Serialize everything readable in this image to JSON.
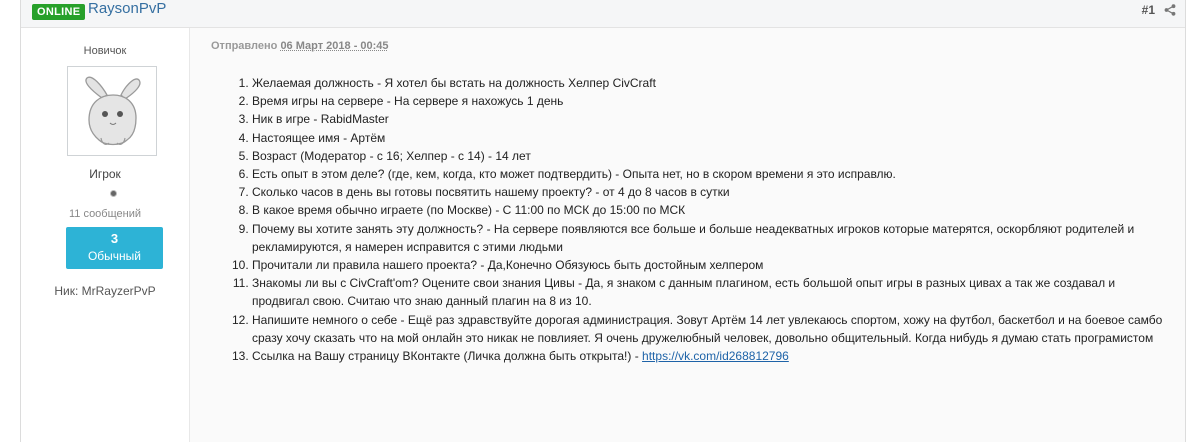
{
  "header": {
    "status_badge": "ONLINE",
    "author": "RaysonPvP",
    "post_number": "#1",
    "share_icon": "share-icon"
  },
  "author_panel": {
    "rank_title": "Новичок",
    "avatar_icon": "rabbit-avatar",
    "group": "Игрок",
    "post_count": "11 сообщений",
    "reputation_value": "3",
    "reputation_label": "Обычный",
    "nick": "Ник: MrRayzerPvP"
  },
  "post": {
    "date_prefix": "Отправлено",
    "date": "06 Март 2018 - 00:45",
    "items": [
      "Желаемая должность - Я хотел бы встать на должность Хелпер CivCraft",
      "Время игры на сервере  - На сервере я нахожусь 1 день",
      "Ник в игре - RabidMaster",
      "Настоящее имя - Артём",
      "Возраст  (Модератор - с 16; Хелпер - с 14) - 14 лет",
      "Есть опыт в этом деле? (где, кем, когда, кто может подтвердить) - Опыта нет, но в скором времени я это исправлю.",
      "Сколько часов в день вы готовы посвятить нашему проекту? - от 4 до 8 часов в сутки",
      "В какое время обычно играете (по Москве) - С 11:00 по МСК до 15:00 по МСК",
      "Почему вы хотите занять эту должность? - На сервере появляются все больше и больше неадекватных игроков которые матерятся, оскорбляют родителей и рекламируются, я намерен исправится с этими людьми",
      "Прочитали ли правила нашего проекта? - Да,Конечно Обязуюсь быть достойным хелпером",
      "Знакомы ли вы с CivCraft'om? Оцените свои знания Цивы - Да, я знаком с данным плагином, есть большой опыт игры в разных цивах а так же создавал и продвигал свою. Считаю что знаю данный плагин на 8 из 10.",
      "Напишите немного о себе - Ещё раз здравствуйте дорогая администрация. Зовут Артём 14 лет увлекаюсь спортом, хожу на футбол, баскетбол и на боевое самбо сразу хочу сказать что на мой онлайн это никак не повлияет. Я очень дружелюбный человек, довольно общительный. Когда нибудь я думаю стать програмистом"
    ],
    "last_item_text": "Ссылка на Вашу страницу ВКонтакте (Личка должна быть открыта!) - ",
    "last_item_link": "https://vk.com/id268812796"
  },
  "colors": {
    "online": "#27a02a",
    "author_link": "#356fa1",
    "reputation": "#2db3d6",
    "link": "#1e63a8"
  }
}
